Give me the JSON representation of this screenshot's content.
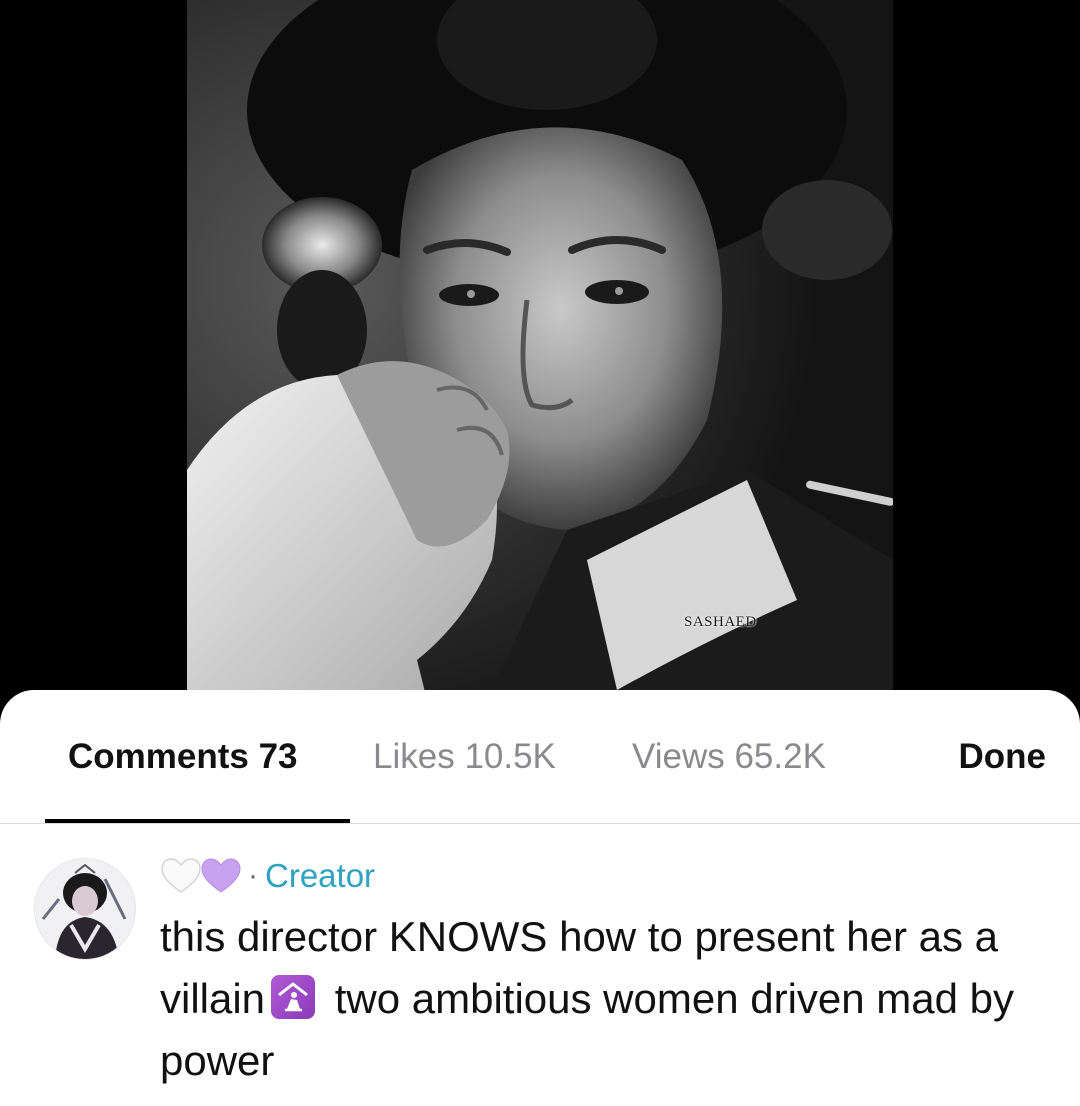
{
  "video": {
    "watermark": "SASHAED"
  },
  "tabs": {
    "comments": {
      "label": "Comments",
      "count": "73"
    },
    "likes": {
      "label": "Likes",
      "count": "10.5K"
    },
    "views": {
      "label": "Views",
      "count": "65.2K"
    },
    "done_label": "Done",
    "active": "comments"
  },
  "comment": {
    "author_hearts": [
      "white-heart-icon",
      "purple-heart-icon"
    ],
    "separator": "·",
    "creator_label": "Creator",
    "text_part1": "this director KNOWS how to present her as a villain",
    "emoji": "place-of-worship-icon",
    "text_part2": "two ambitious women driven mad by power"
  },
  "colors": {
    "creator_accent": "#2fa2bf",
    "tab_active": "#111111",
    "tab_inactive": "#8a8a8e",
    "heart_purple": "#c8a2f0",
    "emoji_bg": "#b15bd8"
  }
}
